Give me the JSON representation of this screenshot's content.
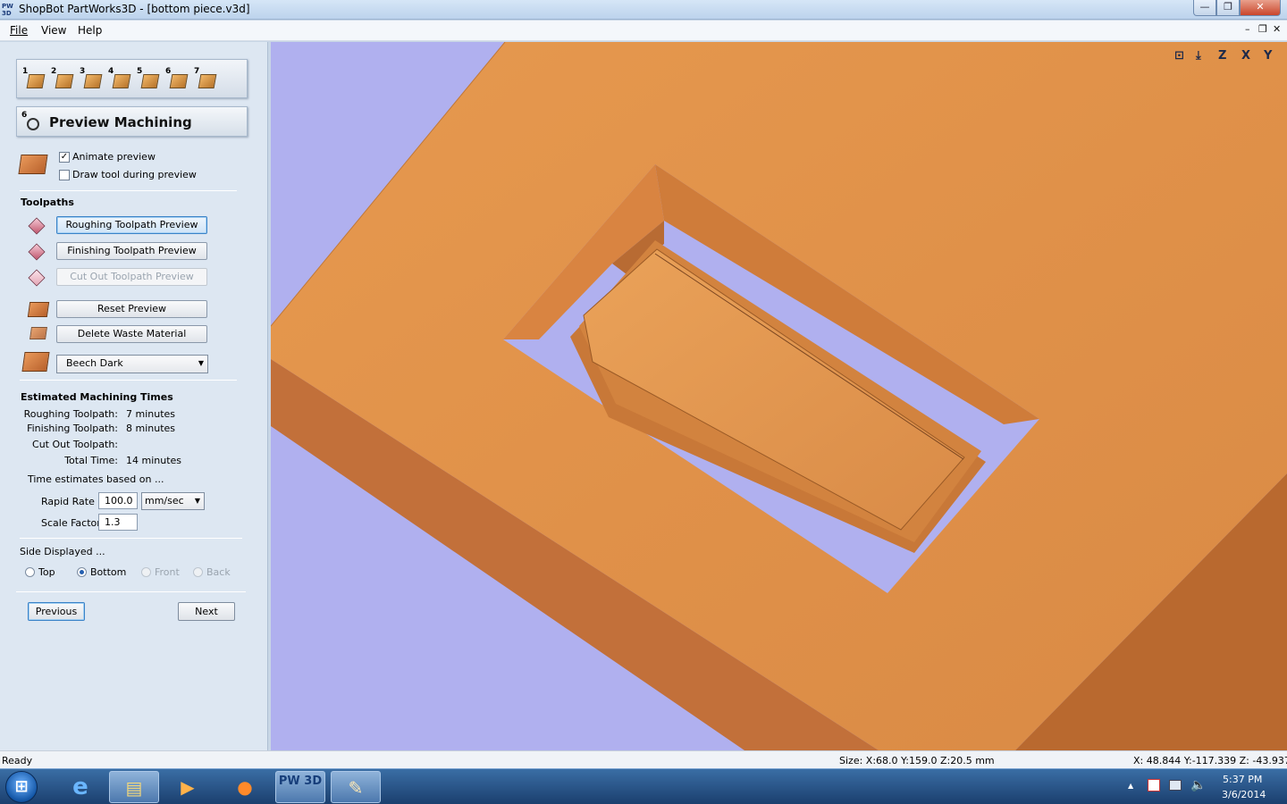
{
  "window": {
    "app_icon": "PW 3D",
    "title": "ShopBot PartWorks3D - [bottom piece.v3d]",
    "min_glyph": "—",
    "max_glyph": "❐",
    "close_glyph": "✕"
  },
  "menu": {
    "file": "File",
    "view": "View",
    "help": "Help",
    "mdi_min": "–",
    "mdi_restore": "❐",
    "mdi_close": "✕"
  },
  "steps": [
    "1",
    "2",
    "3",
    "4",
    "5",
    "6",
    "7"
  ],
  "section": {
    "number": "6",
    "title": "Preview Machining"
  },
  "options": {
    "animate_preview": "Animate preview",
    "animate_checked": true,
    "draw_tool": "Draw tool during preview",
    "draw_tool_checked": false
  },
  "toolpaths": {
    "title": "Toolpaths",
    "roughing": "Roughing Toolpath Preview",
    "finishing": "Finishing Toolpath Preview",
    "cutout": "Cut Out Toolpath Preview",
    "reset": "Reset Preview",
    "delete_waste": "Delete Waste Material",
    "material": "Beech Dark"
  },
  "times": {
    "title": "Estimated Machining Times",
    "rows": [
      {
        "label": "Roughing Toolpath:",
        "value": "7 minutes"
      },
      {
        "label": "Finishing Toolpath:",
        "value": "8 minutes"
      },
      {
        "label": "Cut Out Toolpath:",
        "value": ""
      },
      {
        "label": "Total Time:",
        "value": "14 minutes"
      }
    ],
    "based_on": "Time estimates based on ...",
    "rapid_rate_label": "Rapid Rate",
    "rapid_rate_value": "100.0",
    "rapid_rate_unit": "mm/sec",
    "scale_factor_label": "Scale Factor",
    "scale_factor_value": "1.3"
  },
  "side": {
    "title": "Side Displayed ...",
    "options": [
      "Top",
      "Bottom",
      "Front",
      "Back"
    ],
    "selected": "Bottom"
  },
  "nav": {
    "previous": "Previous",
    "next": "Next"
  },
  "view_icons": [
    "⊡",
    "⤓",
    "Z",
    "X",
    "Y"
  ],
  "status": {
    "ready": "Ready",
    "size": "Size: X:68.0 Y:159.0 Z:20.5 mm",
    "coords": "X:  48.844 Y:-117.339 Z:  -43.937"
  },
  "taskbar": {
    "start": "⊞",
    "ie": "e",
    "explorer": "▤",
    "media": "▶",
    "firefox": "●",
    "pw3d": "PW 3D",
    "paint": "✎",
    "tray_up": "▲",
    "time": "5:37 PM",
    "date": "3/6/2014"
  },
  "colors": {
    "viewport_bg": "#b0b0ef",
    "wood_top": "#e3964f",
    "wood_side": "#c2703a",
    "wood_wall": "#d98441"
  }
}
